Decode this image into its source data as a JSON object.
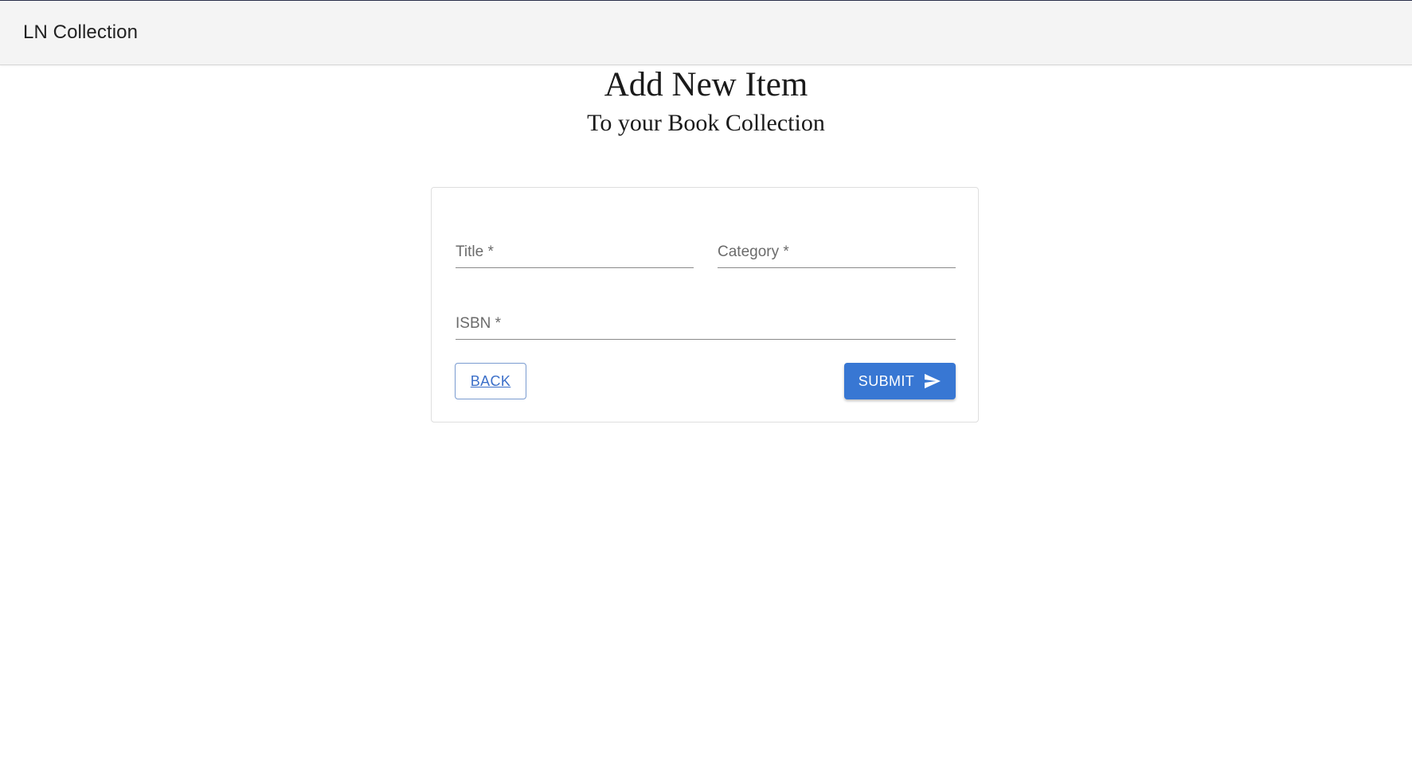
{
  "appbar": {
    "brand": "LN Collection"
  },
  "header": {
    "title": "Add New Item",
    "subtitle": "To your Book Collection"
  },
  "form": {
    "fields": [
      {
        "label": "Title *",
        "value": ""
      },
      {
        "label": "Category *",
        "value": ""
      },
      {
        "label": "ISBN *",
        "value": ""
      }
    ],
    "back_label": "BACK",
    "submit_label": "SUBMIT",
    "submit_icon": "send-icon"
  },
  "colors": {
    "accent": "#3877d3",
    "appbar_bg": "#f4f4f4"
  }
}
